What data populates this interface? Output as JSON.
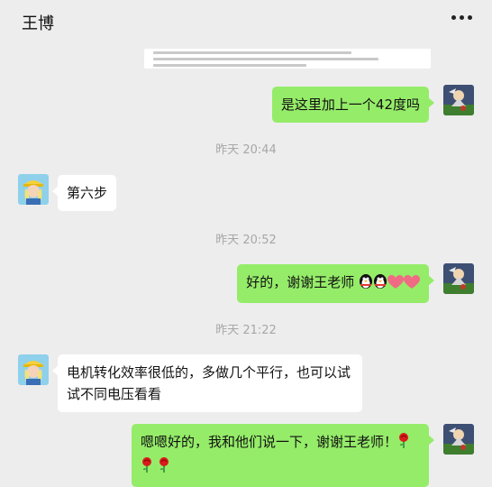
{
  "header": {
    "title": "王博",
    "more_icon": "more-dots-icon"
  },
  "shared_doc": {
    "icon": "document-preview-icon"
  },
  "avatars": {
    "me": "cartoon-rider-avatar-icon",
    "teacher": "blonde-cap-avatar-icon"
  },
  "messages": [
    {
      "sender": "me",
      "text": "是这里加上一个42度吗"
    },
    {
      "type": "time",
      "text": "昨天 20:44"
    },
    {
      "sender": "teacher",
      "text": "第六步"
    },
    {
      "type": "time",
      "text": "昨天 20:52"
    },
    {
      "sender": "me",
      "text": "好的，谢谢王老师",
      "emoji": [
        "penguin",
        "penguin",
        "heart",
        "heart"
      ]
    },
    {
      "type": "time",
      "text": "昨天 21:22"
    },
    {
      "sender": "teacher",
      "line1": "电机转化效率很低的，多做几个平行，也可以试",
      "line2": "试不同电压看看"
    },
    {
      "sender": "me",
      "line1": "嗯嗯好的，我和他们说一下，谢谢王老师！",
      "emoji": [
        "rose",
        "rose",
        "rose"
      ]
    }
  ],
  "colors": {
    "bg": "#ededed",
    "my_bubble": "#95ec69",
    "their_bubble": "#ffffff",
    "time": "#a7a7a7"
  }
}
